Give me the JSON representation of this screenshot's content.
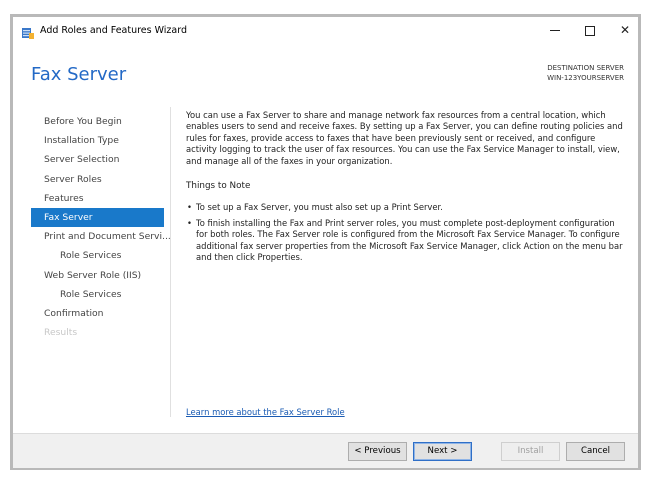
{
  "window": {
    "title": "Add Roles and Features Wizard",
    "icon": "server-manager-icon"
  },
  "header": {
    "page_title": "Fax Server",
    "destination_label": "DESTINATION SERVER",
    "destination_server": "WIN-123YOURSERVER"
  },
  "sidebar": {
    "items": [
      {
        "label": "Before You Begin",
        "state": "normal"
      },
      {
        "label": "Installation Type",
        "state": "normal"
      },
      {
        "label": "Server Selection",
        "state": "normal"
      },
      {
        "label": "Server Roles",
        "state": "normal"
      },
      {
        "label": "Features",
        "state": "normal"
      },
      {
        "label": "Fax Server",
        "state": "active"
      },
      {
        "label": "Print and Document Servi...",
        "state": "normal"
      },
      {
        "label": "Role Services",
        "state": "normal"
      },
      {
        "label": "Web Server Role (IIS)",
        "state": "normal"
      },
      {
        "label": "Role Services",
        "state": "normal"
      },
      {
        "label": "Confirmation",
        "state": "normal"
      },
      {
        "label": "Results",
        "state": "disabled"
      }
    ]
  },
  "content": {
    "intro": "You can use a Fax Server to share and manage network fax resources from a central location, which enables users to send and receive faxes. By setting up a Fax Server, you can define routing policies and rules for faxes, provide access to faxes that have been previously sent or received, and configure activity logging to track the user of fax resources. You can use the Fax Service Manager to install, view, and manage all of the faxes in your organization.",
    "things_heading": "Things to Note",
    "bullets": [
      "To set up a Fax Server, you must also set up a Print Server.",
      "To finish installing the Fax and Print server roles, you must complete post-deployment configuration for both roles. The Fax Server role is configured from the Microsoft Fax Service Manager. To configure additional fax server properties from the Microsoft Fax Service Manager, click Action on the menu bar and then click Properties."
    ],
    "learn_more": "Learn more about the Fax Server Role"
  },
  "footer": {
    "previous_label": "< Previous",
    "next_label": "Next >",
    "install_label": "Install",
    "cancel_label": "Cancel"
  },
  "colors": {
    "title_blue": "#2369c6",
    "active_nav": "#1979ca",
    "link": "#1a5bb3"
  }
}
